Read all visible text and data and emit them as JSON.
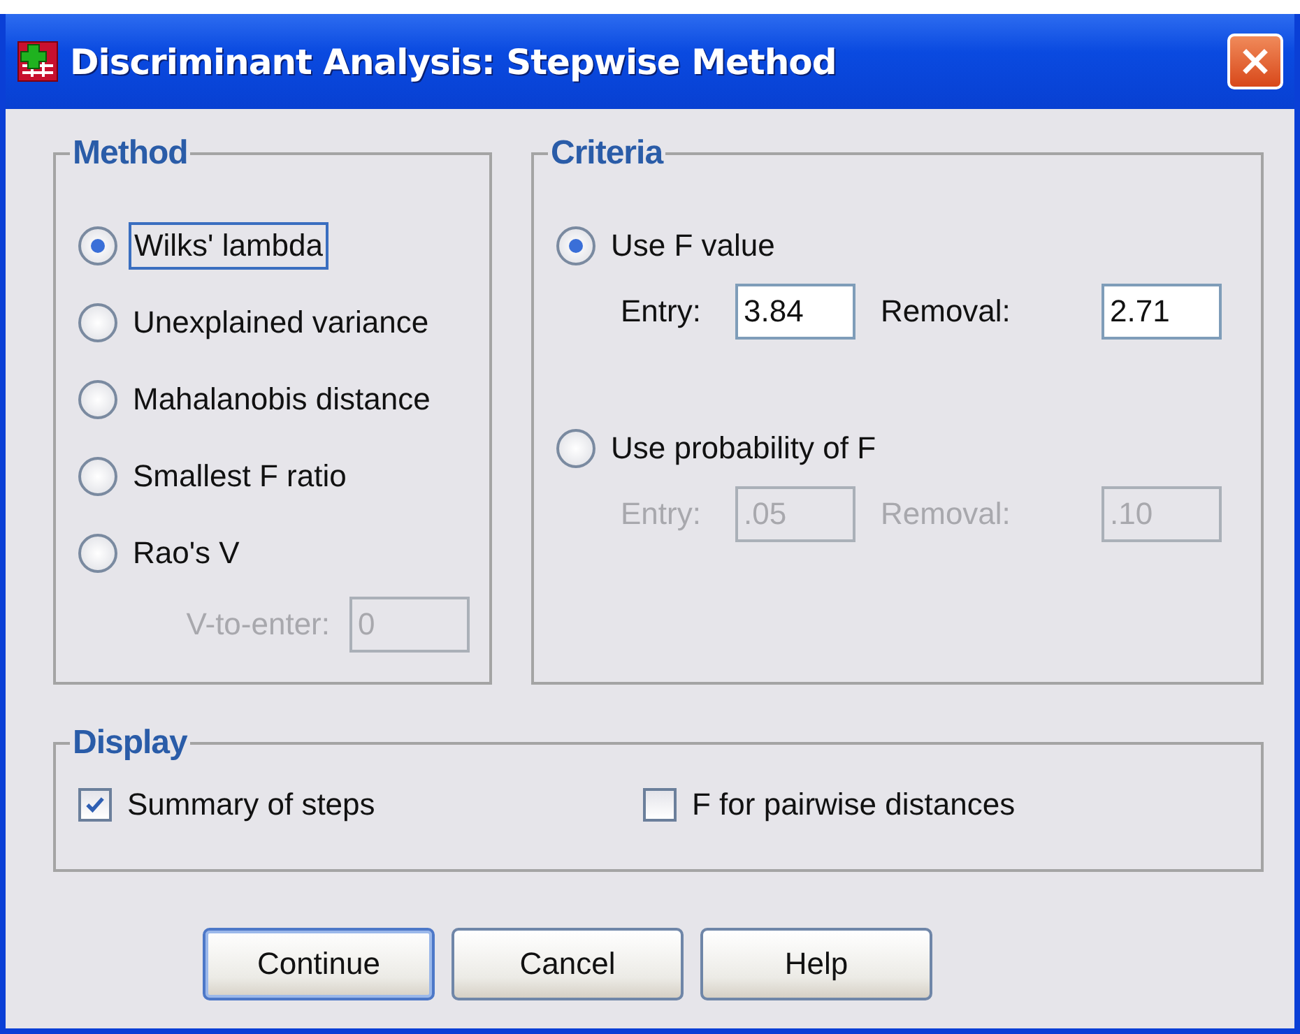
{
  "window": {
    "title": "Discriminant Analysis: Stepwise Method"
  },
  "method": {
    "title": "Method",
    "options": [
      {
        "label": "Wilks' lambda",
        "selected": true,
        "focused": true
      },
      {
        "label": "Unexplained variance",
        "selected": false,
        "focused": false
      },
      {
        "label": "Mahalanobis distance",
        "selected": false,
        "focused": false
      },
      {
        "label": "Smallest F ratio",
        "selected": false,
        "focused": false
      },
      {
        "label": "Rao's V",
        "selected": false,
        "focused": false
      }
    ],
    "v_to_enter": {
      "label": "V-to-enter:",
      "value": "0",
      "disabled": true
    }
  },
  "criteria": {
    "title": "Criteria",
    "options": [
      {
        "label": "Use F value",
        "selected": true,
        "entry": {
          "label": "Entry:",
          "value": "3.84"
        },
        "removal": {
          "label": "Removal:",
          "value": "2.71"
        },
        "disabled": false
      },
      {
        "label": "Use probability of F",
        "selected": false,
        "entry": {
          "label": "Entry:",
          "value": ".05"
        },
        "removal": {
          "label": "Removal:",
          "value": ".10"
        },
        "disabled": true
      }
    ]
  },
  "display": {
    "title": "Display",
    "options": [
      {
        "label": "Summary of steps",
        "checked": true
      },
      {
        "label": "F for pairwise distances",
        "checked": false
      }
    ]
  },
  "buttons": [
    {
      "label": "Continue",
      "default": true
    },
    {
      "label": "Cancel",
      "default": false
    },
    {
      "label": "Help",
      "default": false
    }
  ]
}
